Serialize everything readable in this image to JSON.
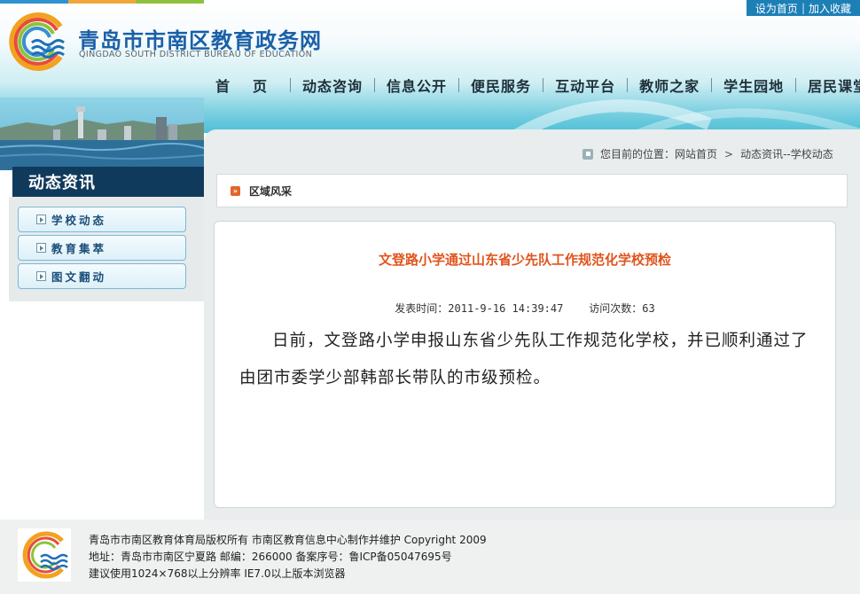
{
  "colors": {
    "brand_blue": "#1a60a8",
    "nav_text": "#1d2f3b",
    "sidebar_title_bg": "#103a5c",
    "article_title": "#e0541c",
    "top_stripes": [
      "#2f93cf",
      "#f0a63b",
      "#8fc23c"
    ]
  },
  "top_links": {
    "set_home": "设为首页",
    "separator": "|",
    "add_favorite": "加入收藏"
  },
  "header": {
    "title": "青岛市市南区教育政务网",
    "subtitle": "QINGDAO SOUTH DISTRICT BUREAU OF EDUCATION",
    "logo_icon": "qingdao-education-logo"
  },
  "nav": {
    "items": [
      {
        "label": "首页"
      },
      {
        "label": "动态咨询"
      },
      {
        "label": "信息公开"
      },
      {
        "label": "便民服务"
      },
      {
        "label": "互动平台"
      },
      {
        "label": "教师之家"
      },
      {
        "label": "学生园地"
      },
      {
        "label": "居民课堂"
      }
    ]
  },
  "sidebar": {
    "title": "动态资讯",
    "items": [
      {
        "label": "学校动态"
      },
      {
        "label": "教育集萃"
      },
      {
        "label": "图文翻动"
      }
    ]
  },
  "breadcrumb": {
    "prefix": "您目前的位置：",
    "home": "网站首页",
    "separator": ">",
    "current": "动态资讯--学校动态"
  },
  "section": {
    "title": "区域风采"
  },
  "article": {
    "title": "文登路小学通过山东省少先队工作规范化学校预检",
    "meta": "发表时间：2011-9-16 14:39:47    访问次数：63",
    "body": "日前，文登路小学申报山东省少先队工作规范化学校，并已顺利通过了由团市委学少部韩部长带队的市级预检。"
  },
  "footer": {
    "lines": [
      "青岛市市南区教育体育局版权所有 市南区教育信息中心制作并维护 Copyright 2009",
      "地址：青岛市市南区宁夏路 邮编：266000 备案序号：鲁ICP备05047695号",
      "建议使用1024×768以上分辨率 IE7.0以上版本浏览器"
    ]
  }
}
